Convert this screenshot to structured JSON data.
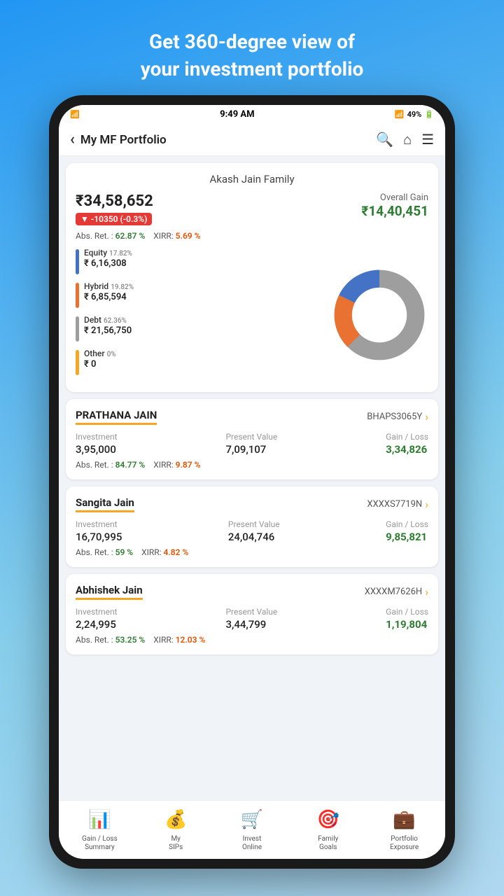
{
  "tagline": {
    "line1": "Get 360-degree view of",
    "line2": "your investment portfolio"
  },
  "statusBar": {
    "time": "9:49 AM",
    "battery": "49%"
  },
  "appBar": {
    "back": "‹",
    "title": "My MF Portfolio",
    "searchIcon": "🔍",
    "homeIcon": "⌂",
    "menuIcon": "≡"
  },
  "summary": {
    "familyName": "Akash Jain Family",
    "totalValue": "₹34,58,652",
    "changeBadge": "▼ -10350  (-0.3%)",
    "overallGainLabel": "Overall Gain",
    "overallGainValue": "₹14,40,451",
    "absRet": "62.87 %",
    "xirr": "5.69 %",
    "legend": [
      {
        "color": "#4472C4",
        "label": "Equity",
        "pct": "17.82%",
        "amount": "₹ 6,16,308"
      },
      {
        "color": "#E97132",
        "label": "Hybrid",
        "pct": "19.82%",
        "amount": "₹ 6,85,594"
      },
      {
        "color": "#9E9E9E",
        "label": "Debt",
        "pct": "62.36%",
        "amount": "₹ 21,56,750"
      },
      {
        "color": "#F5A623",
        "label": "Other",
        "pct": "0%",
        "amount": "₹ 0"
      }
    ],
    "chart": {
      "segments": [
        {
          "color": "#4472C4",
          "pct": 17.82
        },
        {
          "color": "#E97132",
          "pct": 19.82
        },
        {
          "color": "#9E9E9E",
          "pct": 62.36
        }
      ]
    }
  },
  "persons": [
    {
      "name": "PRATHANA JAIN",
      "id": "BHAPS3065Y",
      "investment": "3,95,000",
      "presentValue": "7,09,107",
      "gainLoss": "3,34,826",
      "absRet": "84.77 %",
      "xirr": "9.87 %"
    },
    {
      "name": "Sangita Jain",
      "id": "XXXXS7719N",
      "investment": "16,70,995",
      "presentValue": "24,04,746",
      "gainLoss": "9,85,821",
      "absRet": "59 %",
      "xirr": "4.82 %"
    },
    {
      "name": "Abhishek Jain",
      "id": "XXXXM7626H",
      "investment": "2,24,995",
      "presentValue": "3,44,799",
      "gainLoss": "1,19,804",
      "absRet": "53.25 %",
      "xirr": "12.03 %"
    }
  ],
  "bottomNav": [
    {
      "id": "gain-loss",
      "label": "Gain / Loss\nSummary"
    },
    {
      "id": "my-sips",
      "label": "My\nSIPs"
    },
    {
      "id": "invest-online",
      "label": "Invest\nOnline"
    },
    {
      "id": "family-goals",
      "label": "Family\nGoals"
    },
    {
      "id": "portfolio-exposure",
      "label": "Portfolio\nExposure"
    }
  ],
  "labels": {
    "investment": "Investment",
    "presentValue": "Present Value",
    "gainLoss": "Gain / Loss",
    "absRet": "Abs. Ret. :",
    "xirr": "XIRR:"
  }
}
